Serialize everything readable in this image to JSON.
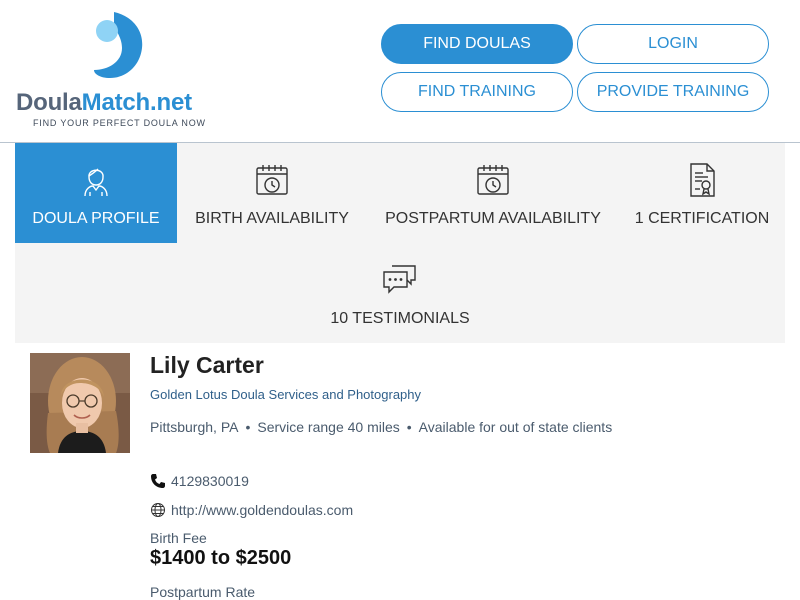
{
  "header": {
    "logo_text_dark": "Doula",
    "logo_text_accent": "Match.net",
    "tagline": "FIND YOUR PERFECT DOULA NOW",
    "buttons": {
      "find_doulas": "FIND DOULAS",
      "login": "LOGIN",
      "find_training": "FIND TRAINING",
      "provide_training": "PROVIDE TRAINING"
    }
  },
  "tabs": [
    {
      "label": "DOULA PROFILE",
      "icon": "doula-avatar-icon",
      "active": true
    },
    {
      "label": "BIRTH AVAILABILITY",
      "icon": "calendar-clock-icon",
      "active": false
    },
    {
      "label": "POSTPARTUM AVAILABILITY",
      "icon": "calendar-clock-icon",
      "active": false
    },
    {
      "label": "1 CERTIFICATION",
      "icon": "certificate-icon",
      "active": false
    },
    {
      "label": "10 TESTIMONIALS",
      "icon": "chat-bubbles-icon",
      "active": false
    }
  ],
  "profile": {
    "name": "Lily Carter",
    "agency": "Golden Lotus Doula Services and Photography",
    "location": "Pittsburgh, PA",
    "service_range": "Service range 40 miles",
    "out_of_state": "Available for out of state clients",
    "phone": "4129830019",
    "website": "http://www.goldendoulas.com",
    "birth_fee_label": "Birth Fee",
    "birth_fee_value": "$1400 to $2500",
    "postpartum_label": "Postpartum Rate"
  },
  "colors": {
    "accent": "#2b8fd3",
    "logo_gray": "#56657a",
    "tab_bg": "#f4f4f4"
  }
}
